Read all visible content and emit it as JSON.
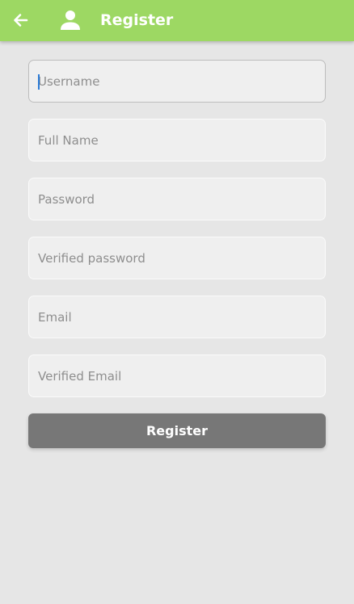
{
  "appbar": {
    "title": "Register",
    "color": "#9dd863",
    "back_icon": "arrow-left-icon",
    "user_icon": "person-icon"
  },
  "form": {
    "username": {
      "placeholder": "Username",
      "value": ""
    },
    "full_name": {
      "placeholder": "Full Name",
      "value": ""
    },
    "password": {
      "placeholder": "Password",
      "value": ""
    },
    "verified_password": {
      "placeholder": "Verified password",
      "value": ""
    },
    "email": {
      "placeholder": "Email",
      "value": ""
    },
    "verified_email": {
      "placeholder": "Verified Email",
      "value": ""
    },
    "submit_label": "Register"
  }
}
